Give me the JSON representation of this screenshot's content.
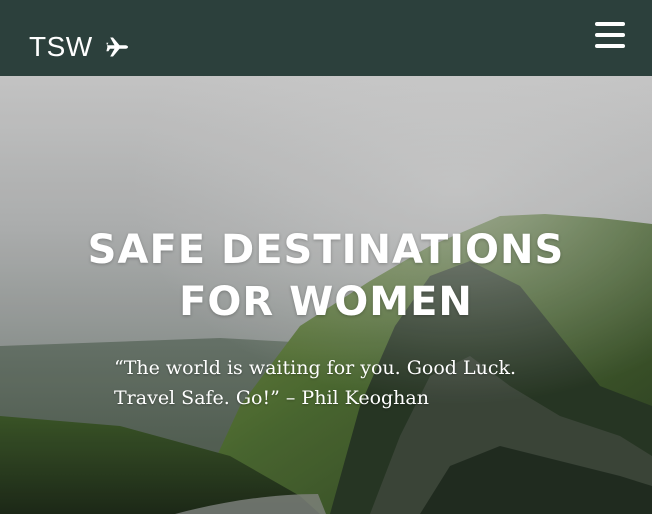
{
  "navbar": {
    "brand_text": "TSW",
    "brand_icon": "airplane-icon",
    "menu_icon": "hamburger-menu-icon",
    "background_color": "#2c403c"
  },
  "hero": {
    "title_line1": "SAFE DESTINATIONS",
    "title_line2": "FOR WOMEN",
    "quote": "“The world is waiting for you. Good Luck. Travel Safe. Go!” – Phil Keoghan"
  }
}
